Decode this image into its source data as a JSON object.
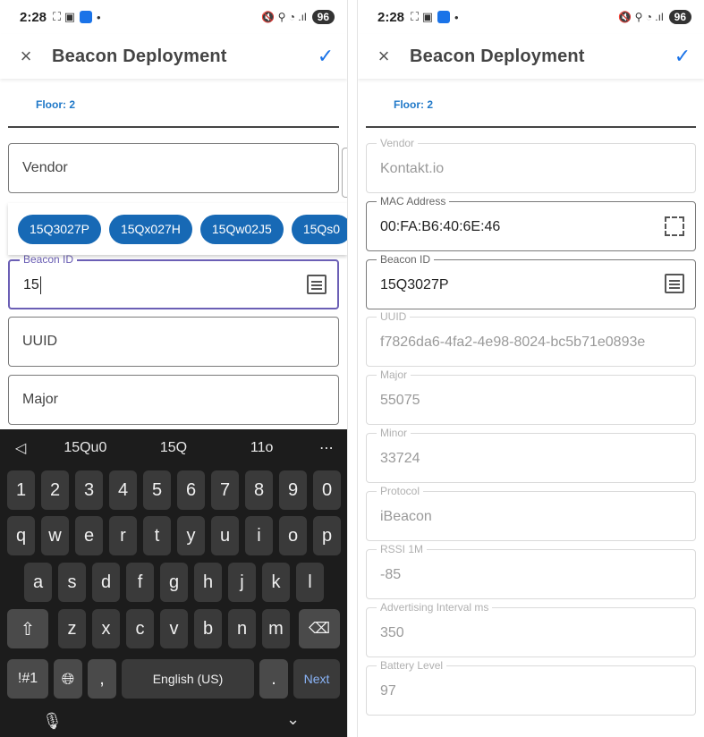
{
  "status": {
    "time": "2:28",
    "battery": "96"
  },
  "appbar": {
    "close_icon": "×",
    "title": "Beacon Deployment",
    "check_icon": "✓"
  },
  "floor_label": "Floor: 2",
  "left": {
    "vendor_placeholder": "Vendor",
    "chips": [
      "15Q3027P",
      "15Qx027H",
      "15Qw02J5",
      "15Qs0"
    ],
    "beacon_label": "Beacon ID",
    "beacon_value": "15",
    "uuid_placeholder": "UUID",
    "major_placeholder": "Major"
  },
  "keyboard": {
    "suggestions": [
      "15Qu0",
      "15Q",
      "11o"
    ],
    "row_digits": [
      "1",
      "2",
      "3",
      "4",
      "5",
      "6",
      "7",
      "8",
      "9",
      "0"
    ],
    "row_q": [
      "q",
      "w",
      "e",
      "r",
      "t",
      "y",
      "u",
      "i",
      "o",
      "p"
    ],
    "row_a": [
      "a",
      "s",
      "d",
      "f",
      "g",
      "h",
      "j",
      "k",
      "l"
    ],
    "row_z": [
      "z",
      "x",
      "c",
      "v",
      "b",
      "n",
      "m"
    ],
    "sym": "!#1",
    "comma": ",",
    "space": "English (US)",
    "period": ".",
    "next": "Next"
  },
  "right": {
    "fields": [
      {
        "label": "Vendor",
        "value": "Kontakt.io"
      },
      {
        "label": "MAC Address",
        "value": "00:FA:B6:40:6E:46"
      },
      {
        "label": "Beacon ID",
        "value": "15Q3027P"
      },
      {
        "label": "UUID",
        "value": "f7826da6-4fa2-4e98-8024-bc5b71e0893e"
      },
      {
        "label": "Major",
        "value": "55075"
      },
      {
        "label": "Minor",
        "value": "33724"
      },
      {
        "label": "Protocol",
        "value": "iBeacon"
      },
      {
        "label": "RSSI 1M",
        "value": "-85"
      },
      {
        "label": "Advertising Interval ms",
        "value": "350"
      },
      {
        "label": "Battery Level",
        "value": "97"
      }
    ]
  }
}
